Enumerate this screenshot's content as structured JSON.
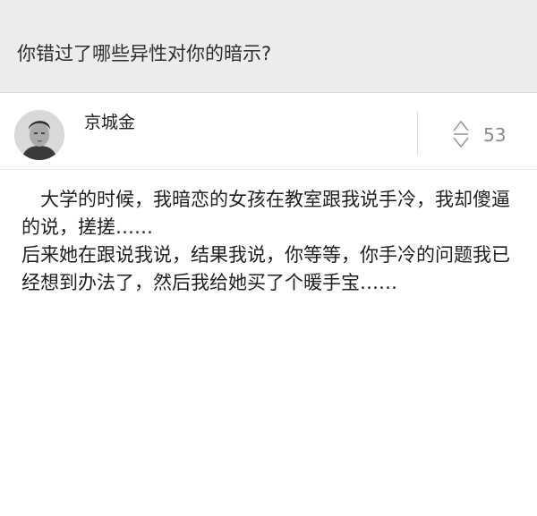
{
  "question": {
    "title": "你错过了哪些异性对你的暗示?"
  },
  "answer": {
    "author": "京城金",
    "avatar_icon": "user-avatar",
    "vote_icon": "vote-arrows-icon",
    "votes": "53",
    "paragraphs": [
      "　大学的时候，我暗恋的女孩在教室跟我说手冷，我却傻逼的说，搓搓……",
      "后来她在跟说我说，结果我说，你等等，你手冷的问题我已经想到办法了，然后我给她买了个暖手宝……"
    ]
  }
}
